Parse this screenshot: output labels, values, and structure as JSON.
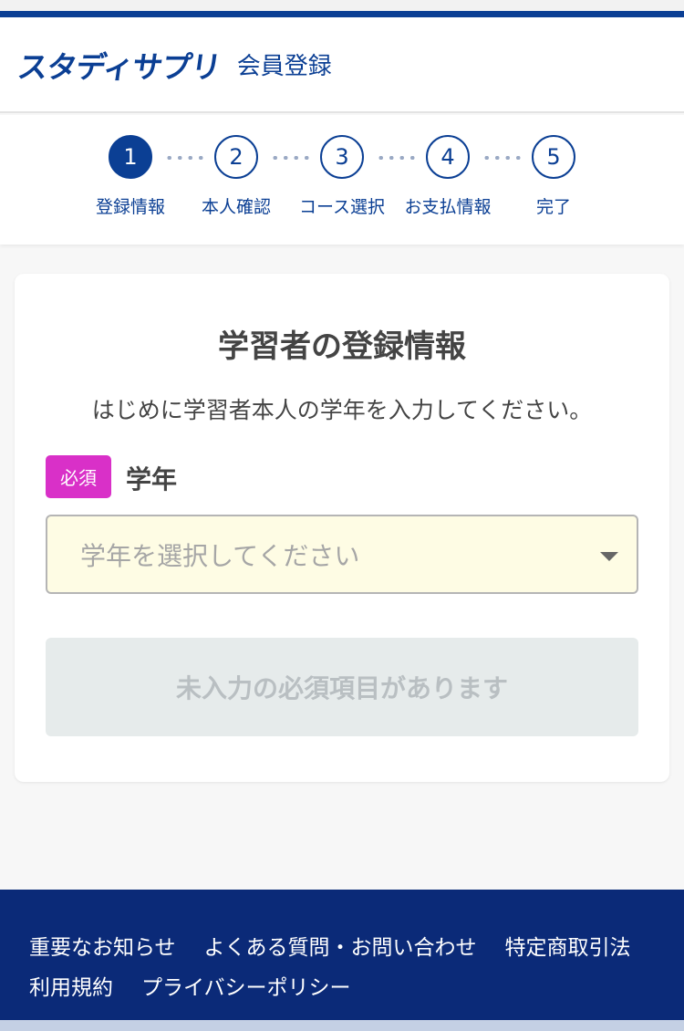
{
  "colors": {
    "brand": "#0b3f94",
    "required_badge": "#d930c8",
    "footer_bg": "#0b2a78",
    "select_bg": "#fefce4"
  },
  "header": {
    "logo": "スタディサプリ",
    "title": "会員登録"
  },
  "stepper": {
    "current_step": 1,
    "steps": [
      {
        "number": "1",
        "label": "登録情報"
      },
      {
        "number": "2",
        "label": "本人確認"
      },
      {
        "number": "3",
        "label": "コース選択"
      },
      {
        "number": "4",
        "label": "お支払情報"
      },
      {
        "number": "5",
        "label": "完了"
      }
    ]
  },
  "form": {
    "title": "学習者の登録情報",
    "description": "はじめに学習者本人の学年を入力してください。",
    "required_badge": "必須",
    "field_label": "学年",
    "select_placeholder": "学年を選択してください",
    "submit_label": "未入力の必須項目があります"
  },
  "footer": {
    "links_row1": [
      "重要なお知らせ",
      "よくある質問・お問い合わせ",
      "特定商取引法"
    ],
    "links_row2": [
      "利用規約",
      "プライバシーポリシー"
    ]
  }
}
